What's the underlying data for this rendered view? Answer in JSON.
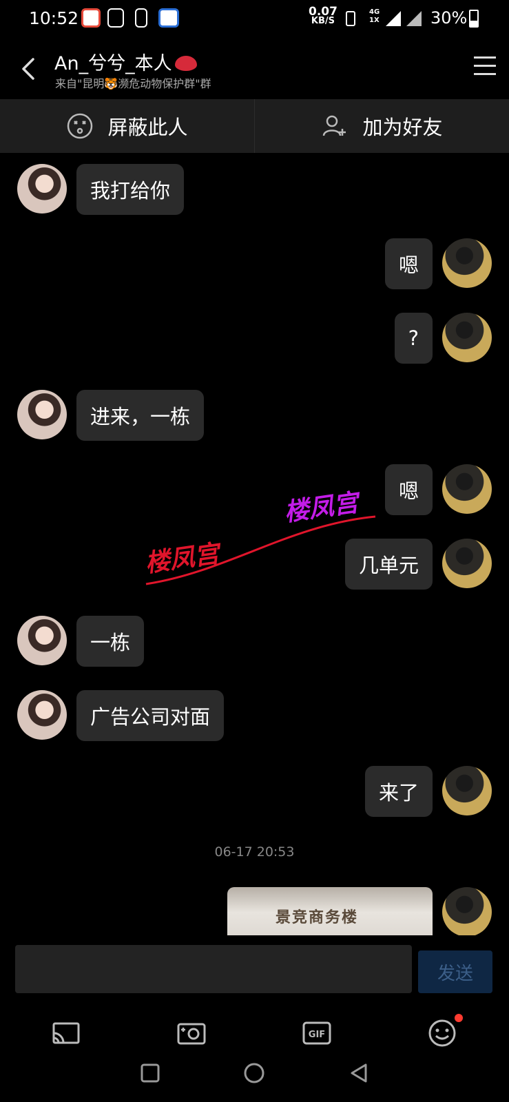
{
  "status": {
    "time": "10:52",
    "speed_value": "0.07",
    "speed_unit": "KB/S",
    "network_top": "4G",
    "network_bottom": "1X",
    "battery": "30%"
  },
  "header": {
    "title": "An_兮兮_本人",
    "subtitle": "来自\"昆明🐯濒危动物保护群\"群"
  },
  "actions": {
    "block": "屏蔽此人",
    "add_friend": "加为好友"
  },
  "messages": [
    {
      "side": "left",
      "text": "我打给你"
    },
    {
      "side": "right",
      "text": "嗯"
    },
    {
      "side": "right",
      "text": "?"
    },
    {
      "side": "left",
      "text": "进来，一栋"
    },
    {
      "side": "right",
      "text": "嗯"
    },
    {
      "side": "right",
      "text": "几单元"
    },
    {
      "side": "left",
      "text": "一栋"
    },
    {
      "side": "left",
      "text": "广告公司对面"
    },
    {
      "side": "right",
      "text": "来了"
    }
  ],
  "timestamp": "06-17 20:53",
  "photo_caption": "景竞商务楼",
  "watermark": {
    "red": "楼凤宫",
    "purple": "楼凤宫"
  },
  "composer": {
    "placeholder": "",
    "send": "发送"
  },
  "toolbar": {
    "gif": "GIF"
  }
}
